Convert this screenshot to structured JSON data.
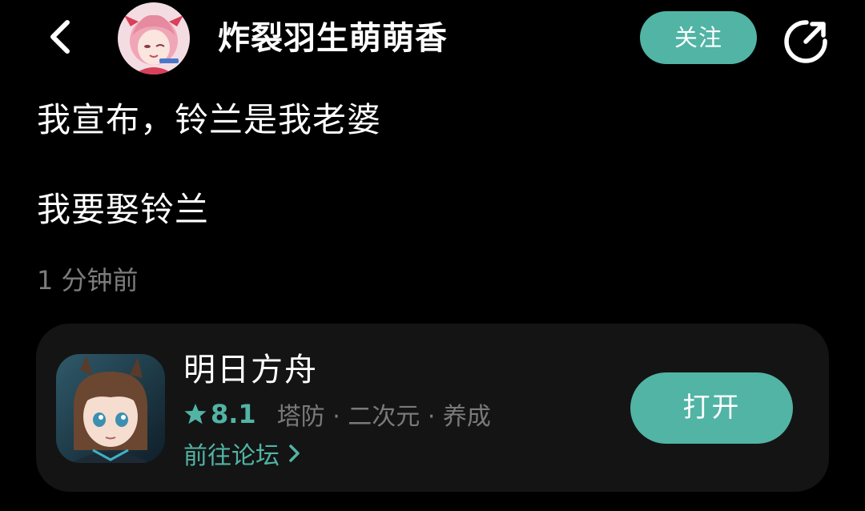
{
  "header": {
    "username": "炸裂羽生萌萌香",
    "follow_label": "关注"
  },
  "post": {
    "line1": "我宣布，铃兰是我老婆",
    "line2": "我要娶铃兰",
    "time": "1 分钟前"
  },
  "app_card": {
    "name": "明日方舟",
    "rating": "8.1",
    "tags": "塔防 · 二次元 · 养成",
    "forum_link": "前往论坛",
    "open_label": "打开"
  },
  "icons": {
    "back": "chevron-left-icon",
    "share": "share-icon",
    "star": "star-icon",
    "forum_chevron": "chevron-right-icon"
  },
  "colors": {
    "background": "#000000",
    "accent": "#51b4a5",
    "card": "#141414",
    "muted_text": "#7c7c7c"
  }
}
